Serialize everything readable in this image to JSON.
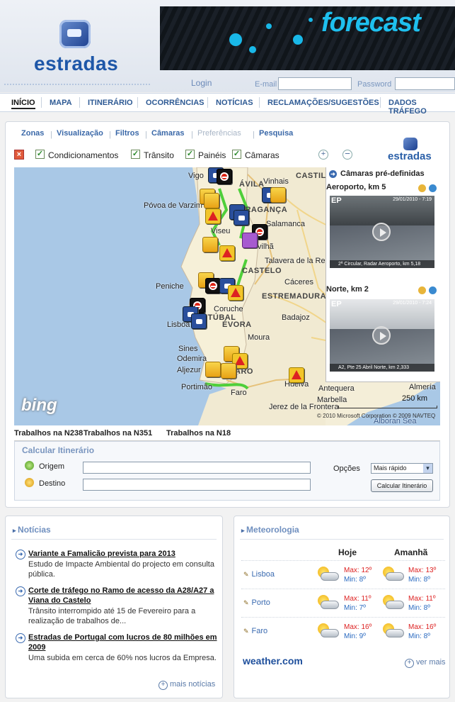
{
  "header": {
    "logo_text": "estradas",
    "banner_text": "forecast",
    "login_label": "Login",
    "email_label": "E-mail",
    "password_label": "Password",
    "email_value": "",
    "password_value": ""
  },
  "nav": {
    "items": [
      "INÍCIO",
      "MAPA",
      "ITINERÁRIO",
      "OCORRÊNCIAS",
      "NOTÍCIAS",
      "RECLAMAÇÕES/SUGESTÕES",
      "DADOS TRÁFEGO"
    ],
    "active": "INÍCIO"
  },
  "map_panel": {
    "tabs": [
      "Zonas",
      "Visualização",
      "Filtros",
      "Câmaras",
      "Preferências",
      "Pesquisa"
    ],
    "disabled_tab": "Preferências",
    "layers": [
      "Condicionamentos",
      "Trânsito",
      "Painéis",
      "Câmaras"
    ],
    "mini_logo": "estradas",
    "zoom_in": "+",
    "zoom_out": "−"
  },
  "map": {
    "provider": "bing",
    "scale_label": "250 km",
    "copyright": "© 2010 Microsoft Corporation  © 2009 NAVTEQ",
    "regions": [
      "CASTILLA",
      "CASTELO",
      "ESTREMADURA",
      "ÉVORA",
      "SETÚBAL",
      "ÁVILA",
      "BRAGANÇA",
      "ARO"
    ],
    "towns": [
      "Vigo",
      "Vinhais",
      "Póvoa de Varzim",
      "Viseu",
      "Salamanca",
      "Covilhã",
      "Talavera de la Reina",
      "Peniche",
      "Cáceres",
      "Coruche",
      "Lisboa",
      "Badajoz",
      "Moura",
      "Sines",
      "Odemira",
      "Aljezur",
      "Portimão",
      "Faro",
      "Huelva",
      "Antequera",
      "Jerez de la Frontera",
      "Marbella",
      "Almería",
      "Alboran Sea"
    ]
  },
  "cameras": {
    "header": "Câmaras pré-definidas",
    "items": [
      {
        "title": "Aeroporto, km 5",
        "stamp": "29/01/2010 - 7:19",
        "caption": "2ª Circular, Radar Aeroporto, km 5,18",
        "brand": "EP"
      },
      {
        "title": "Norte, km 2",
        "stamp": "29/01/2010 - 7:24",
        "caption": "A2, Pte 25 Abril Norte, km 2,333",
        "brand": "EP"
      }
    ]
  },
  "ticker": [
    "Trabalhos na N238",
    "Trabalhos na N351",
    "Trabalhos na N18"
  ],
  "route": {
    "title": "Calcular Itinerário",
    "origin_label": "Origem",
    "destination_label": "Destino",
    "origin_value": "",
    "destination_value": "",
    "options_label": "Opções",
    "options_selected": "Mais rápido",
    "submit_label": "Calcular Itinerário"
  },
  "news": {
    "title": "Notícias",
    "items": [
      {
        "headline": "Variante a Famalicão prevista para 2013",
        "text": "Estudo de Impacte Ambiental do projecto em consulta pública."
      },
      {
        "headline": "Corte de tráfego no Ramo de acesso da A28/A27 a Viana do Castelo",
        "text": "Trânsito interrompido até 15 de Fevereiro para a realização de trabalhos de..."
      },
      {
        "headline": "Estradas de Portugal com lucros de 80 milhões em 2009",
        "text": "Uma subida em cerca de 60% nos lucros da Empresa."
      }
    ],
    "more": "mais notícias"
  },
  "weather": {
    "title": "Meteorologia",
    "col_today": "Hoje",
    "col_tomorrow": "Amanhã",
    "rows": [
      {
        "city": "Lisboa",
        "today_max": "Max: 12º",
        "today_min": "Min: 8º",
        "tom_max": "Max: 13º",
        "tom_min": "Min: 8º"
      },
      {
        "city": "Porto",
        "today_max": "Max: 11º",
        "today_min": "Min: 7º",
        "tom_max": "Max: 11º",
        "tom_min": "Min: 8º"
      },
      {
        "city": "Faro",
        "today_max": "Max: 16º",
        "today_min": "Min: 9º",
        "tom_max": "Max: 16º",
        "tom_min": "Min: 8º"
      }
    ],
    "provider": "weather.com",
    "more": "ver mais"
  }
}
